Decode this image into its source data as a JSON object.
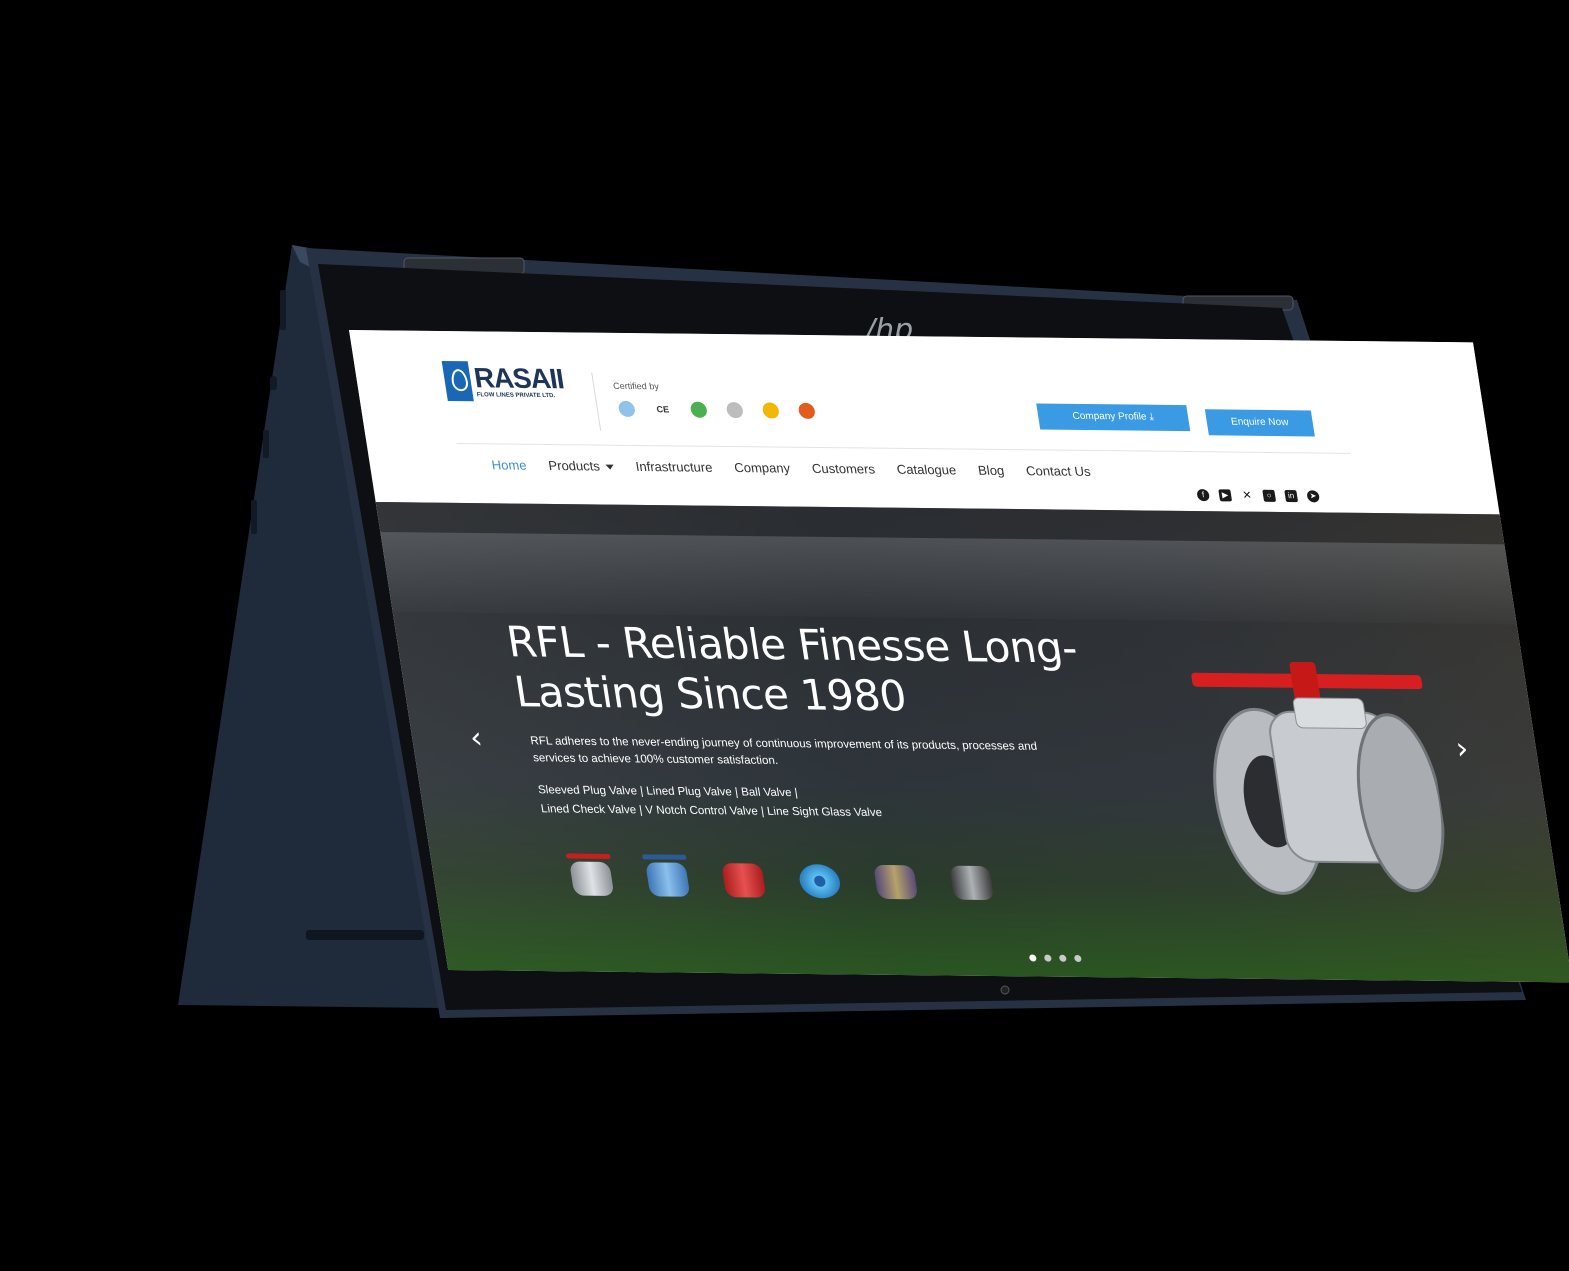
{
  "brand": {
    "name": "RASAII",
    "subtitle": "FLOW LINES PRIVATE LTD."
  },
  "header": {
    "certified_label": "Certified by",
    "certifications": [
      "ce-mark",
      "green-seal",
      "grey-seal",
      "gold-seal",
      "flame-seal",
      "blue-seal"
    ],
    "company_profile_button": "Company Profile",
    "enquire_button": "Enquire Now"
  },
  "nav": {
    "items": [
      {
        "label": "Home",
        "active": true
      },
      {
        "label": "Products",
        "has_dropdown": true
      },
      {
        "label": "Infrastructure"
      },
      {
        "label": "Company"
      },
      {
        "label": "Customers"
      },
      {
        "label": "Catalogue"
      },
      {
        "label": "Blog"
      },
      {
        "label": "Contact Us"
      }
    ],
    "social_icons": [
      "facebook-icon",
      "youtube-icon",
      "x-icon",
      "instagram-icon",
      "linkedin-icon",
      "telegram-icon"
    ]
  },
  "hero": {
    "title": "RFL - Reliable Finesse Long-Lasting Since 1980",
    "description": "RFL adheres to the never-ending journey of continuous improvement of its products, processes and services to achieve 100% customer satisfaction.",
    "product_line_1": "Sleeved Plug Valve | Lined Plug Valve | Ball Valve |",
    "product_line_2": "Lined Check Valve | V Notch Control Valve | Line Sight Glass Valve",
    "slide_count": 4,
    "active_slide": 1
  },
  "colors": {
    "accent": "#3a9ae4",
    "brand_blue": "#1a67b5",
    "device_body": "#263244"
  }
}
